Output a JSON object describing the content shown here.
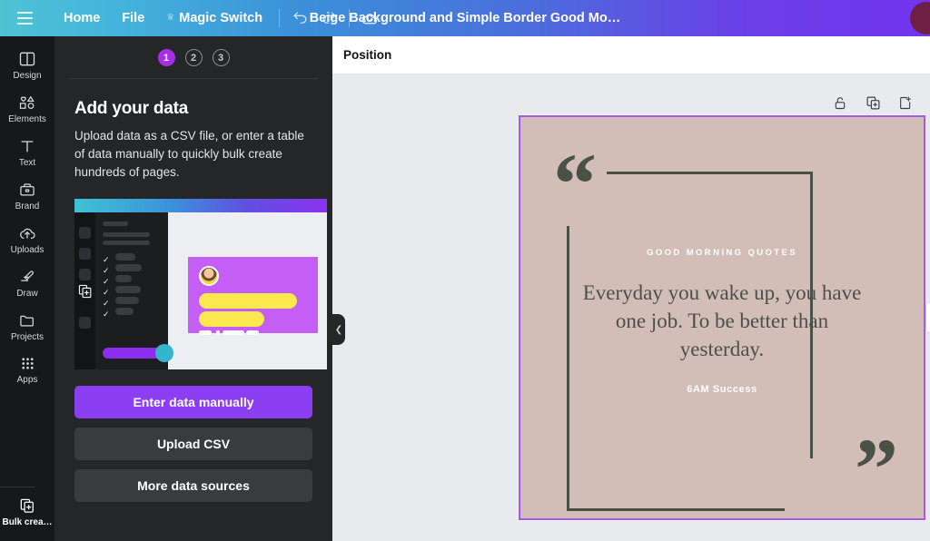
{
  "topbar": {
    "menu_icon": "hamburger-icon",
    "home_label": "Home",
    "file_label": "File",
    "magic_switch_label": "Magic Switch",
    "crown_icon": "crown-icon",
    "undo_icon": "undo-icon",
    "redo_icon": "redo-icon",
    "cloud_icon": "cloud-saved-icon",
    "doc_title": "Beige Background and Simple Border Good Mo…",
    "avatar": "user-avatar"
  },
  "rail": {
    "items": [
      {
        "label": "Design",
        "icon": "design-icon"
      },
      {
        "label": "Elements",
        "icon": "elements-icon"
      },
      {
        "label": "Text",
        "icon": "text-icon"
      },
      {
        "label": "Brand",
        "icon": "brand-icon"
      },
      {
        "label": "Uploads",
        "icon": "uploads-icon"
      },
      {
        "label": "Draw",
        "icon": "draw-icon"
      },
      {
        "label": "Projects",
        "icon": "projects-icon"
      },
      {
        "label": "Apps",
        "icon": "apps-icon"
      }
    ],
    "bottom": {
      "label": "Bulk crea…",
      "icon": "bulk-create-icon"
    }
  },
  "panel": {
    "steps": [
      "1",
      "2",
      "3"
    ],
    "active_step": "1",
    "heading": "Add your data",
    "description": "Upload data as a CSV file, or enter a table of data manually to quickly bulk create hundreds of pages.",
    "buttons": {
      "primary": "Enter data manually",
      "upload": "Upload CSV",
      "more": "More data sources"
    },
    "collapse_icon": "chevron-left-icon"
  },
  "main": {
    "position_label": "Position",
    "tools": [
      {
        "name": "unlock-icon"
      },
      {
        "name": "duplicate-page-icon"
      },
      {
        "name": "add-page-icon"
      }
    ]
  },
  "design": {
    "open_quote": "“",
    "close_quote": "”",
    "eyebrow": "GOOD MORNING QUOTES",
    "quote": "Everyday you wake up, you have one job. To be better than yesterday.",
    "author": "6AM Success",
    "colors": {
      "background": "#d3bdb7",
      "frame": "#4a5147",
      "text": "#4c4f4c",
      "accent_text": "#ffffff",
      "selection": "#a259f0"
    }
  },
  "theme": {
    "brand_purple": "#8b3ef2",
    "panel_bg": "#252627",
    "rail_bg": "#17181c",
    "canvas_bg": "#e9eaee"
  }
}
